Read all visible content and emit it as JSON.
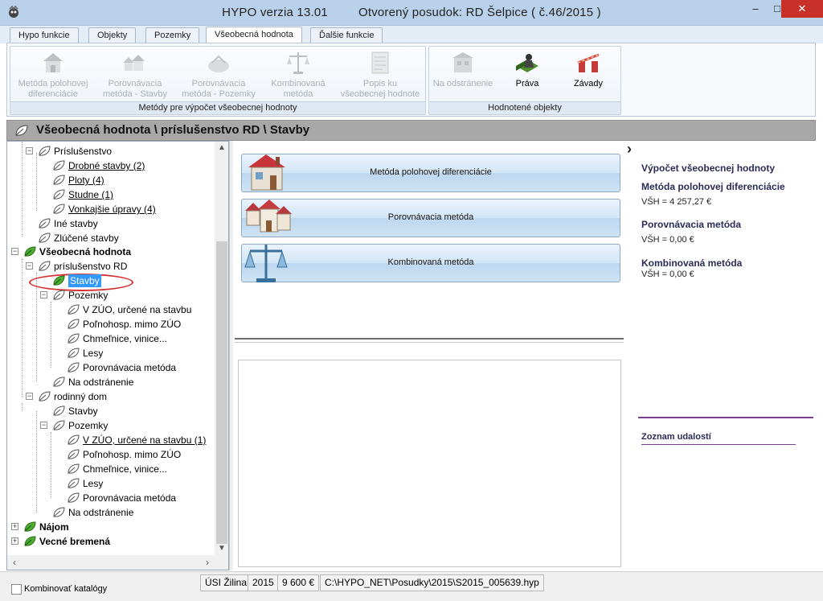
{
  "window": {
    "title_app": "HYPO verzia 13.01",
    "title_doc": "Otvorený posudok: RD Šelpice ( č.46/2015 )",
    "min_label": "–",
    "max_label": "□",
    "close_label": "✕"
  },
  "tabs": [
    {
      "label": "Hypo funkcie"
    },
    {
      "label": "Objekty"
    },
    {
      "label": "Pozemky"
    },
    {
      "label": "Všeobecná hodnota"
    },
    {
      "label": "Ďalšie funkcie"
    }
  ],
  "ribbon": {
    "group1": {
      "label": "Metódy pre výpočet všeobecnej hodnoty",
      "buttons": [
        {
          "line1": "Metóda polohovej",
          "line2": "diferenciácie",
          "icon": "house-icon"
        },
        {
          "line1": "Porovnávacia",
          "line2": "metóda - Stavby",
          "icon": "houses-icon"
        },
        {
          "line1": "Porovnávacia",
          "line2": "metóda - Pozemky",
          "icon": "land-icon"
        },
        {
          "line1": "Kombinovaná",
          "line2": "metóda",
          "icon": "scales-icon"
        },
        {
          "line1": "Popis ku",
          "line2": "všeobecnej hodnote",
          "icon": "document-icon"
        }
      ]
    },
    "group2": {
      "label": "Hodnotené objekty",
      "buttons": [
        {
          "line1": "Na odstránenie",
          "icon": "demolition-icon"
        },
        {
          "line1": "Práva",
          "icon": "rights-icon"
        },
        {
          "line1": "Závady",
          "icon": "defects-icon"
        }
      ]
    }
  },
  "breadcrumb": {
    "text": "Všeobecná hodnota \\ príslušenstvo RD \\ Stavby"
  },
  "tree": {
    "items": [
      {
        "label": "Príslušenstvo"
      },
      {
        "label": "Drobné stavby (2)"
      },
      {
        "label": "Ploty (4)"
      },
      {
        "label": "Studne (1)"
      },
      {
        "label": "Vonkajšie úpravy (4)"
      },
      {
        "label": "Iné stavby"
      },
      {
        "label": "Zlúčené stavby"
      },
      {
        "label": "Všeobecná hodnota"
      },
      {
        "label": "príslušenstvo RD"
      },
      {
        "label": "Stavby"
      },
      {
        "label": "Pozemky"
      },
      {
        "label": "V ZÚO, určené na stavbu"
      },
      {
        "label": "Poľnohosp. mimo ZÚO"
      },
      {
        "label": "Chmeľnice, vinice..."
      },
      {
        "label": "Lesy"
      },
      {
        "label": "Porovnávacia metóda"
      },
      {
        "label": "Na odstránenie"
      },
      {
        "label": "rodinný dom"
      },
      {
        "label": "Stavby"
      },
      {
        "label": "Pozemky"
      },
      {
        "label": "V ZÚO, určené na stavbu (1)"
      },
      {
        "label": "Poľnohosp. mimo ZÚO"
      },
      {
        "label": "Chmeľnice, vinice..."
      },
      {
        "label": "Lesy"
      },
      {
        "label": "Porovnávacia metóda"
      },
      {
        "label": "Na odstránenie"
      },
      {
        "label": "Nájom"
      },
      {
        "label": "Vecné bremená"
      }
    ]
  },
  "methods": [
    {
      "label": "Metóda polohovej diferenciácie",
      "icon": "house-icon"
    },
    {
      "label": "Porovnávacia metóda",
      "icon": "houses-icon"
    },
    {
      "label": "Kombinovaná metóda",
      "icon": "scales-icon"
    }
  ],
  "summary": {
    "title": "Výpočet všeobecnej hodnoty",
    "m1_name": "Metóda polohovej diferenciácie",
    "m1_value": "VŠH = 4 257,27 €",
    "m2_name": "Porovnávacia metóda",
    "m2_value": "VŠH = 0,00 €",
    "m3_name": "Kombinovaná metóda",
    "m3_value": "VŠH = 0,00 €",
    "events_title": "Zoznam udalostí"
  },
  "status": {
    "checkbox_label": "Kombinovať katalógy",
    "office": "ÚSI Žilina",
    "year": "2015",
    "price": "9 600  €",
    "path": "C:\\HYPO_NET\\Posudky\\2015\\S2015_005639.hyp"
  },
  "colors": {
    "titlebar": "#b9d1ea",
    "close": "#c7312a",
    "selection": "#3399ff",
    "summary_heading": "#2b2b55",
    "events_line": "#7b3f8f"
  }
}
